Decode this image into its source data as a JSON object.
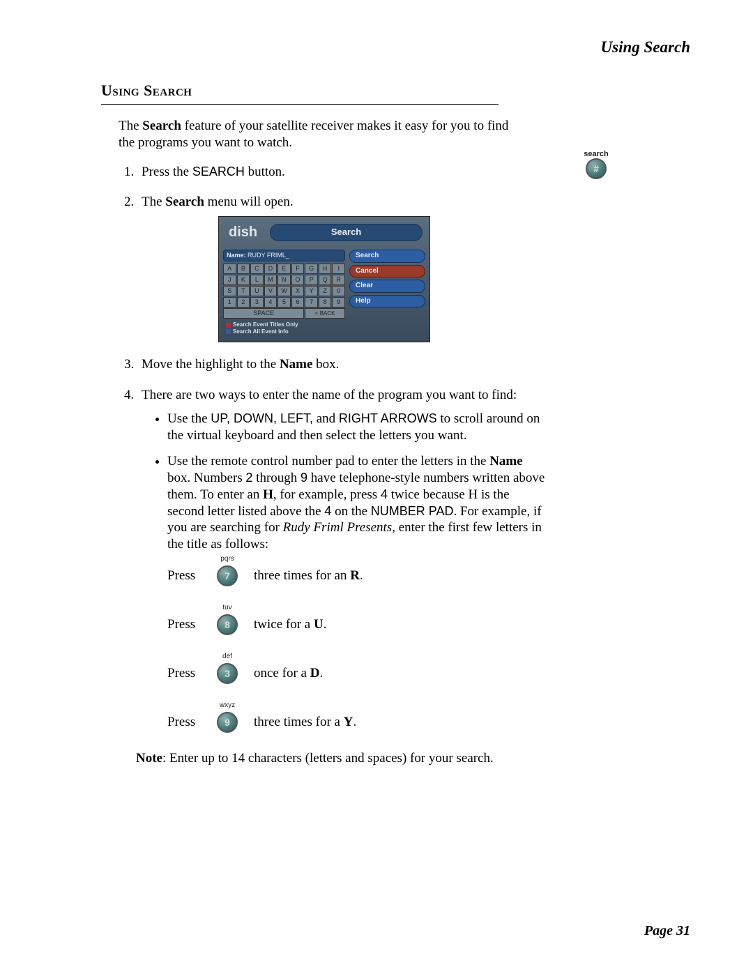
{
  "header": {
    "running": "Using Search"
  },
  "section_title": "Using Search",
  "intro": {
    "pre": "The ",
    "bold": "Search",
    "post": " feature of your satellite receiver makes it easy for you to find the programs you want to watch."
  },
  "search_icon": {
    "label": "search",
    "glyph": "#"
  },
  "steps": {
    "s1": {
      "pre": "Press the ",
      "sc": "SEARCH",
      "post": " button."
    },
    "s2": {
      "pre": "The ",
      "bold": "Search",
      "post": " menu will open."
    },
    "s3": {
      "pre": "Move the highlight to the ",
      "bold": "Name",
      "post": " box."
    },
    "s4": "There are two ways to enter the name of the program you want to find:"
  },
  "screenshot": {
    "logo": "dish",
    "title": "Search",
    "name_label": "Name:",
    "name_value": "RUDY FRIML_",
    "keys": [
      "A",
      "B",
      "C",
      "D",
      "E",
      "F",
      "G",
      "H",
      "I",
      "J",
      "K",
      "L",
      "M",
      "N",
      "O",
      "P",
      "Q",
      "R",
      "S",
      "T",
      "U",
      "V",
      "W",
      "X",
      "Y",
      "Z",
      "0",
      "1",
      "2",
      "3",
      "4",
      "5",
      "6",
      "7",
      "8",
      "9"
    ],
    "space": "SPACE",
    "back": "< BACK",
    "buttons": {
      "search": "Search",
      "cancel": "Cancel",
      "clear": "Clear",
      "help": "Help"
    },
    "opt1": "Search Event Titles Only",
    "opt2": "Search All Event Info"
  },
  "bullet1": {
    "pre": "Use the ",
    "sc": "UP, DOWN, LEFT,",
    "mid": " and ",
    "sc2": "RIGHT ARROWS",
    "post": " to scroll around on the virtual keyboard and then select the letters you want."
  },
  "bullet2": {
    "t1": "Use the remote control number pad to enter the letters in the ",
    "b1": "Name",
    "t2": " box. Numbers ",
    "sc1": "2",
    "t3": " through ",
    "sc2": "9",
    "t4": " have telephone-style numbers written above them. To enter an ",
    "b2": "H",
    "t5": ", for example, press ",
    "sc3": "4",
    "t6": " twice because H is the second letter listed above the ",
    "sc4": "4",
    "t7": " on the ",
    "sc5": "NUMBER PAD",
    "t8": ". For example, if you are searching for ",
    "it": "Rudy Friml Presents",
    "t9": ", enter the first few letters in the title as follows:"
  },
  "press": {
    "label": "Press",
    "rows": [
      {
        "letters": "pqrs",
        "digit": "7",
        "desc_pre": "three times for an ",
        "desc_b": "R",
        "desc_post": "."
      },
      {
        "letters": "tuv",
        "digit": "8",
        "desc_pre": "twice for a ",
        "desc_b": "U",
        "desc_post": "."
      },
      {
        "letters": "def",
        "digit": "3",
        "desc_pre": "once for a ",
        "desc_b": "D",
        "desc_post": "."
      },
      {
        "letters": "wxyz",
        "digit": "9",
        "desc_pre": "three times for a ",
        "desc_b": "Y",
        "desc_post": "."
      }
    ]
  },
  "note": {
    "b": "Note",
    "t": ": Enter up to 14 characters (letters and spaces) for your search."
  },
  "page_number": "Page 31"
}
